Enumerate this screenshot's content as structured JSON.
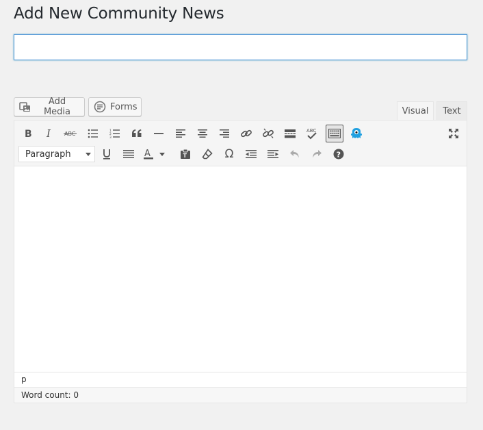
{
  "page": {
    "title": "Add New Community News"
  },
  "title_field": {
    "value": "",
    "placeholder": ""
  },
  "media_buttons": {
    "add_media_label": "Add Media",
    "forms_label": "Forms"
  },
  "editor_tabs": [
    {
      "label": "Visual",
      "active": true
    },
    {
      "label": "Text",
      "active": false
    }
  ],
  "toolbar": {
    "row1": [
      "bold",
      "italic",
      "strikethrough",
      "bullet-list",
      "numbered-list",
      "blockquote",
      "horizontal-line",
      "align-left",
      "align-center",
      "align-right",
      "insert-link",
      "remove-link",
      "read-more",
      "spellcheck",
      "toolbar-toggle",
      "plugin-monster",
      "fullscreen"
    ],
    "format_select": {
      "selected": "Paragraph"
    },
    "row2": [
      "underline",
      "justify",
      "text-color",
      "paste-as-text",
      "clear-formatting",
      "special-character",
      "decrease-indent",
      "increase-indent",
      "undo",
      "redo",
      "keyboard-shortcuts"
    ],
    "spellcheck_text": "ABC",
    "strike_text": "ABC",
    "special_char": "Ω"
  },
  "editor": {
    "content": "",
    "path": "p",
    "word_count": "Word count: 0"
  },
  "colors": {
    "accent": "#5b9dd9",
    "background": "#f1f1f1",
    "text": "#23282d",
    "monster": "#21a0e0"
  }
}
